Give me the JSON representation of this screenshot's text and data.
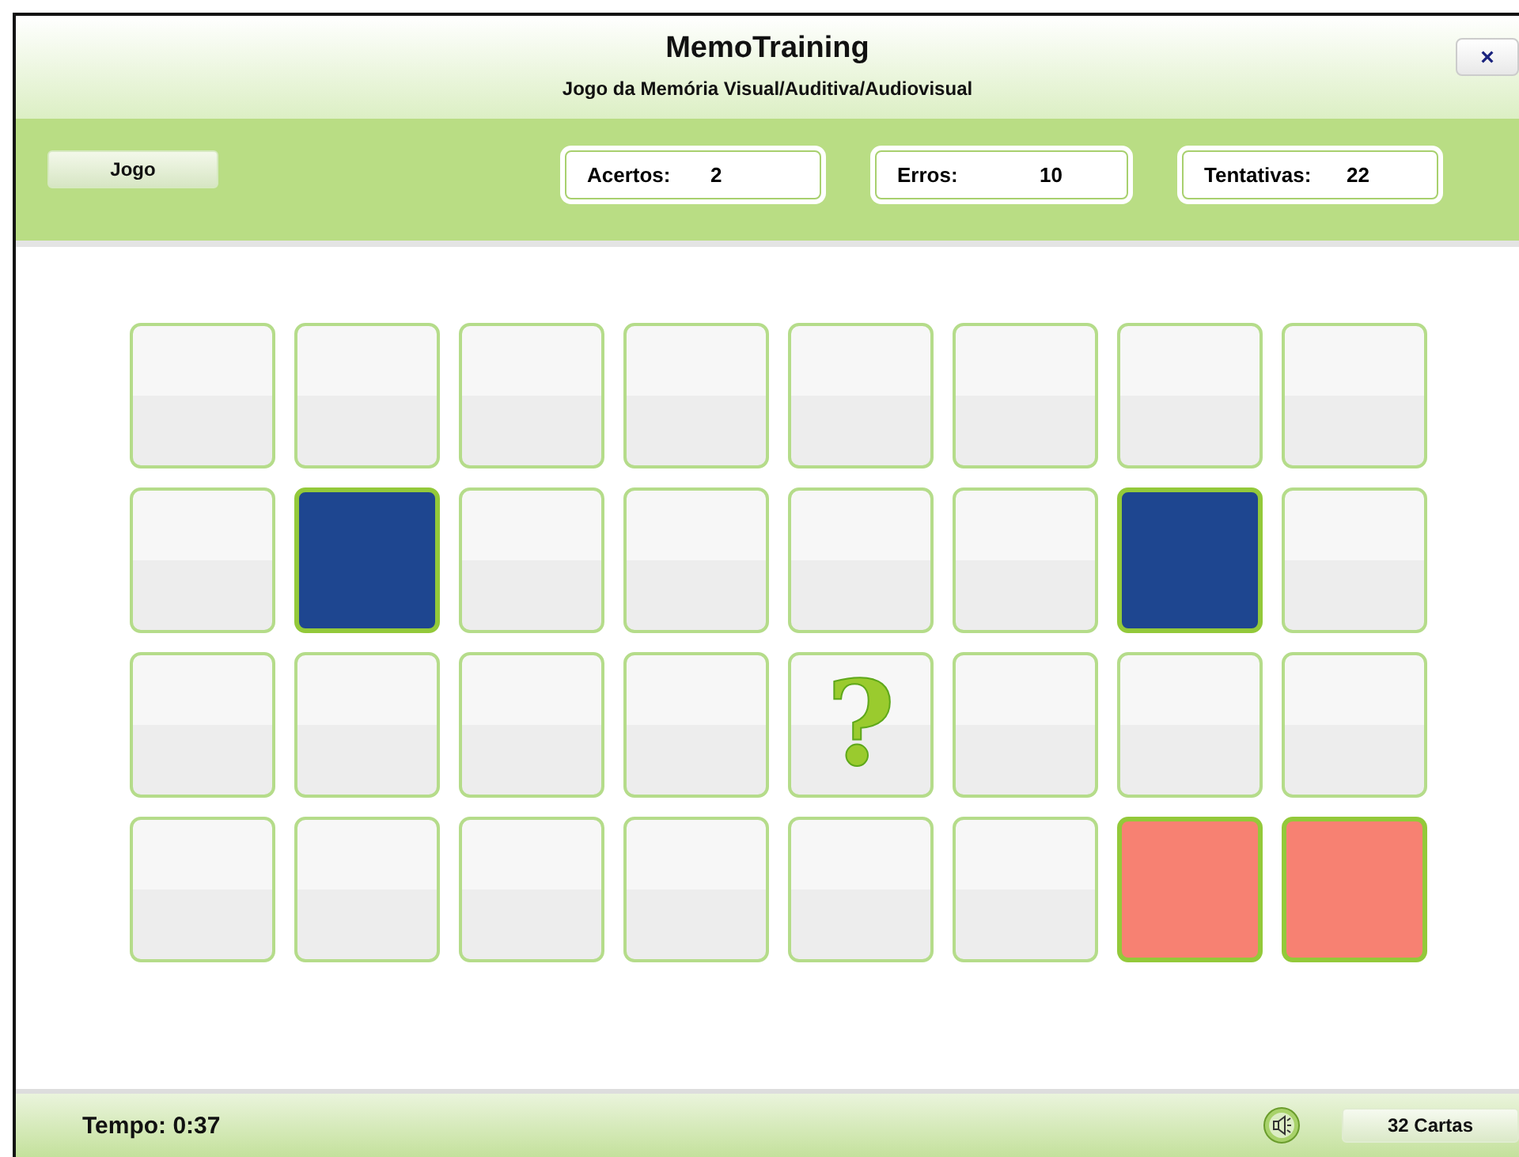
{
  "window": {
    "title": "MemoTraining",
    "subtitle": "Jogo da Memória Visual/Auditiva/Audiovisual",
    "close": "×"
  },
  "toolbar": {
    "menu_button": "Jogo",
    "stats": [
      {
        "label": "Acertos:",
        "value": "2"
      },
      {
        "label": "Erros:",
        "value": "10"
      },
      {
        "label": "Tentativas:",
        "value": "22"
      }
    ]
  },
  "cards": [
    {
      "kind": "hidden"
    },
    {
      "kind": "hidden"
    },
    {
      "kind": "hidden"
    },
    {
      "kind": "hidden"
    },
    {
      "kind": "hidden"
    },
    {
      "kind": "hidden"
    },
    {
      "kind": "hidden"
    },
    {
      "kind": "hidden"
    },
    {
      "kind": "hidden"
    },
    {
      "kind": "revealed",
      "color": "#1e4690"
    },
    {
      "kind": "hidden"
    },
    {
      "kind": "hidden"
    },
    {
      "kind": "hidden"
    },
    {
      "kind": "hidden"
    },
    {
      "kind": "revealed",
      "color": "#1e4690"
    },
    {
      "kind": "hidden"
    },
    {
      "kind": "hidden"
    },
    {
      "kind": "hidden"
    },
    {
      "kind": "hidden"
    },
    {
      "kind": "hidden"
    },
    {
      "kind": "question",
      "label": "?"
    },
    {
      "kind": "hidden"
    },
    {
      "kind": "hidden"
    },
    {
      "kind": "hidden"
    },
    {
      "kind": "hidden"
    },
    {
      "kind": "hidden"
    },
    {
      "kind": "hidden"
    },
    {
      "kind": "hidden"
    },
    {
      "kind": "hidden"
    },
    {
      "kind": "hidden"
    },
    {
      "kind": "revealed",
      "color": "#f78172"
    },
    {
      "kind": "revealed",
      "color": "#f78172"
    }
  ],
  "status_bar": {
    "time": "Tempo: 0:37",
    "cards_button": "32 Cartas"
  }
}
